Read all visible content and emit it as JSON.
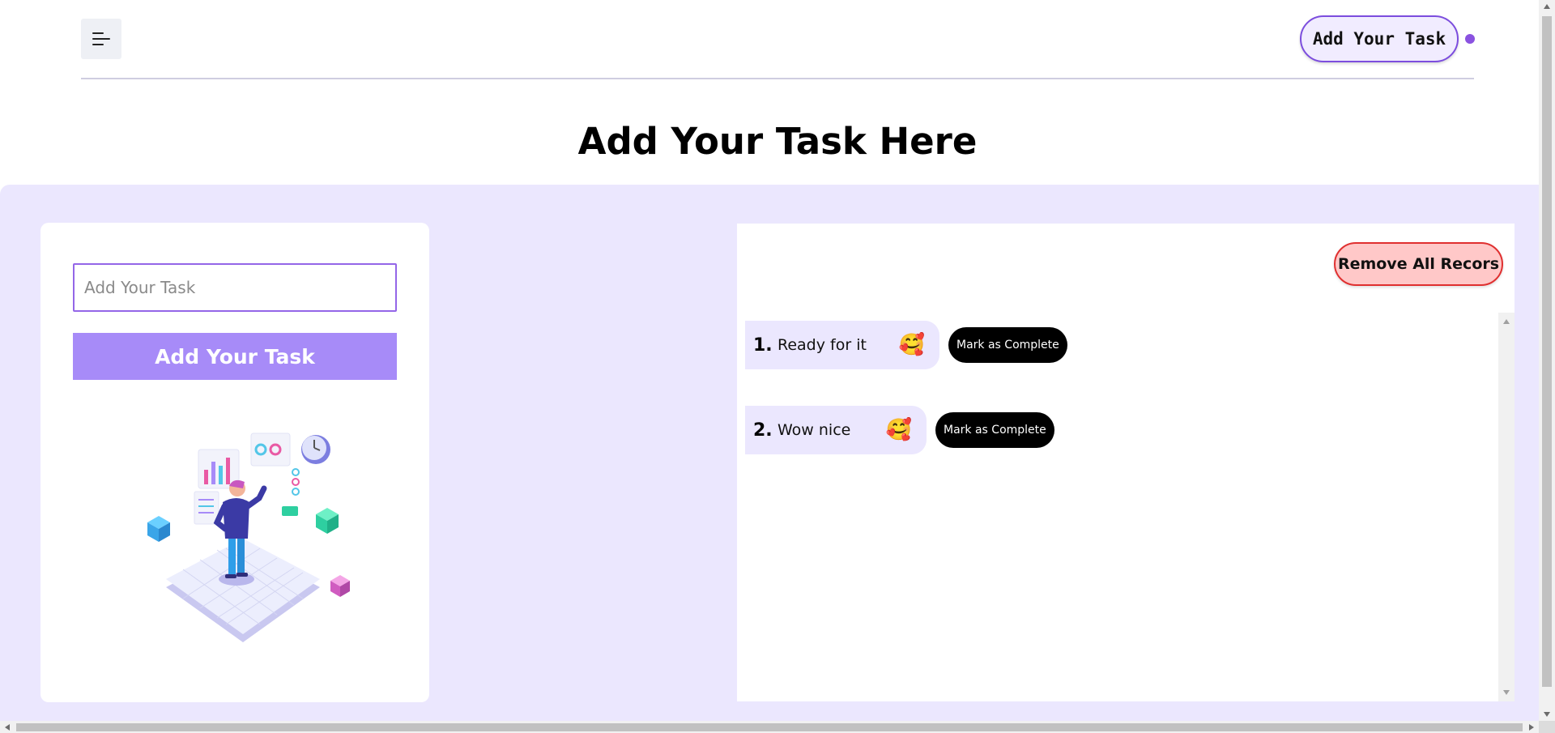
{
  "header": {
    "menu_icon": "hamburger-menu-icon",
    "nav_button_label": "Add Your Task",
    "status_dot_color": "#8a52e0"
  },
  "page_title": "Add Your Task Here",
  "form": {
    "input_placeholder": "Add Your Task",
    "input_value": "",
    "submit_label": "Add Your Task",
    "illustration": "isometric-dashboard-person-illustration"
  },
  "tasks_panel": {
    "remove_all_label": "Remove All Recors",
    "items": [
      {
        "number": "1.",
        "text": "Ready for it",
        "emoji": "🥰",
        "action_label": "Mark as Complete"
      },
      {
        "number": "2.",
        "text": "Wow nice",
        "emoji": "🥰",
        "action_label": "Mark as Complete"
      }
    ]
  },
  "colors": {
    "accent": "#a78bf8",
    "band_background": "#ebe7fe",
    "remove_button_bg": "#ffc8c8",
    "remove_button_border": "#e03030"
  }
}
